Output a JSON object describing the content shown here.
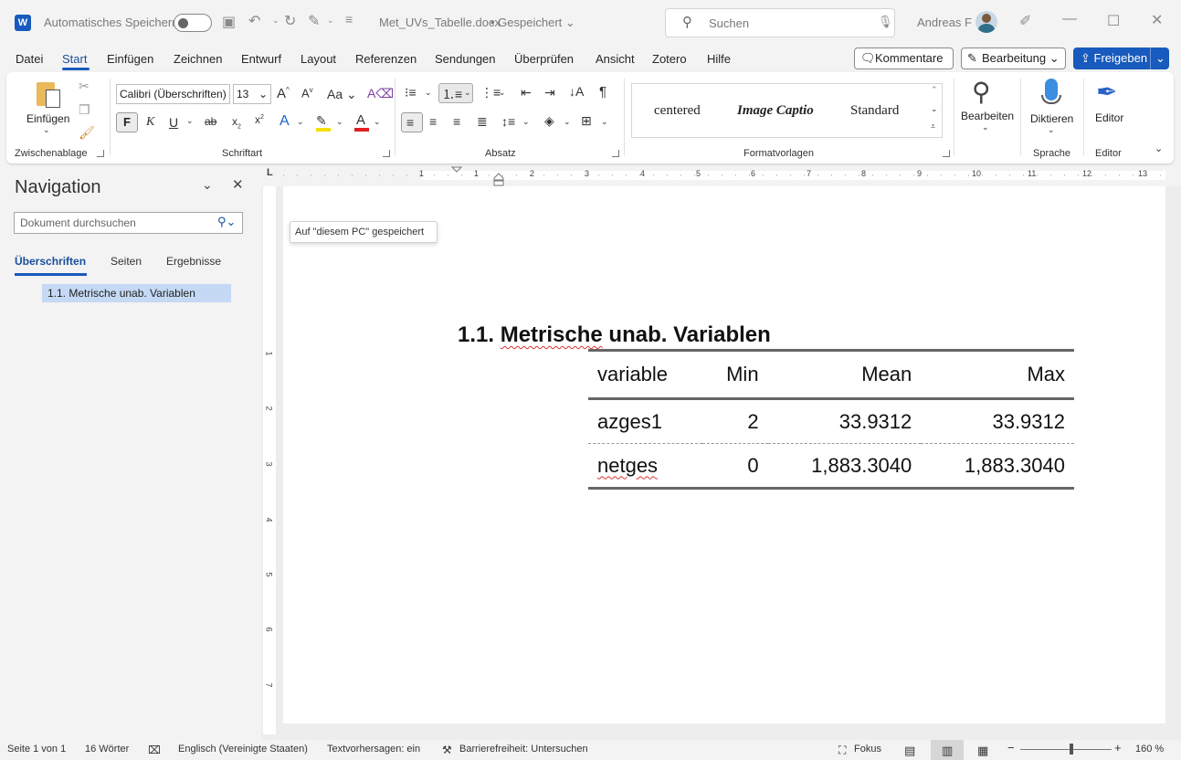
{
  "titlebar": {
    "autosave_label": "Automatisches Speichern",
    "doc_title": "Met_UVs_Tabelle.docx",
    "save_status": "Gespeichert",
    "search_placeholder": "Suchen",
    "user_name": "Andreas F"
  },
  "menubar": {
    "items": [
      "Datei",
      "Start",
      "Einfügen",
      "Zeichnen",
      "Entwurf",
      "Layout",
      "Referenzen",
      "Sendungen",
      "Überprüfen",
      "Ansicht",
      "Zotero",
      "Hilfe"
    ],
    "active": "Start",
    "comments_label": "Kommentare",
    "editing_label": "Bearbeitung",
    "share_label": "Freigeben"
  },
  "ribbon": {
    "clipboard": {
      "paste_label": "Einfügen",
      "group_label": "Zwischenablage"
    },
    "font": {
      "font_name": "Calibri (Überschriften)",
      "font_size": "13",
      "group_label": "Schriftart",
      "bold": "F",
      "italic": "K",
      "underline": "U"
    },
    "paragraph": {
      "group_label": "Absatz"
    },
    "styles": {
      "items": [
        "centered",
        "Image Captio",
        "Standard"
      ],
      "group_label": "Formatvorlagen"
    },
    "editing": {
      "label": "Bearbeiten"
    },
    "voice": {
      "label": "Diktieren",
      "group_label": "Sprache"
    },
    "editor": {
      "label": "Editor",
      "group_label": "Editor"
    }
  },
  "navigation": {
    "title": "Navigation",
    "search_placeholder": "Dokument durchsuchen",
    "tabs": [
      "Überschriften",
      "Seiten",
      "Ergebnisse"
    ],
    "active_tab": "Überschriften",
    "headings": [
      "1.1. Metrische unab. Variablen"
    ]
  },
  "tooltip": "Auf \"diesem PC\" gespeichert",
  "ruler_numbers": [
    "1",
    "1",
    "2",
    "3",
    "4",
    "5",
    "6",
    "7",
    "8",
    "9",
    "10",
    "11",
    "12",
    "13"
  ],
  "vruler_numbers": [
    "1",
    "2",
    "3",
    "4",
    "5",
    "6",
    "7"
  ],
  "document": {
    "heading_number": "1.1.",
    "heading_text_a": "Metrische",
    "heading_text_b": "unab. Variablen",
    "table": {
      "headers": [
        "variable",
        "Min",
        "Mean",
        "Max"
      ],
      "rows": [
        [
          "azges1",
          "2",
          "33.9312",
          "33.9312"
        ],
        [
          "netges",
          "0",
          "1,883.3040",
          "1,883.3040"
        ]
      ]
    }
  },
  "statusbar": {
    "page": "Seite 1 von 1",
    "words": "16 Wörter",
    "language": "Englisch (Vereinigte Staaten)",
    "text_predictions": "Textvorhersagen: ein",
    "accessibility": "Barrierefreiheit: Untersuchen",
    "focus": "Fokus",
    "zoom": "160 %"
  },
  "colors": {
    "accent": "#185abd",
    "nav_highlight": "#c5d9f4"
  }
}
